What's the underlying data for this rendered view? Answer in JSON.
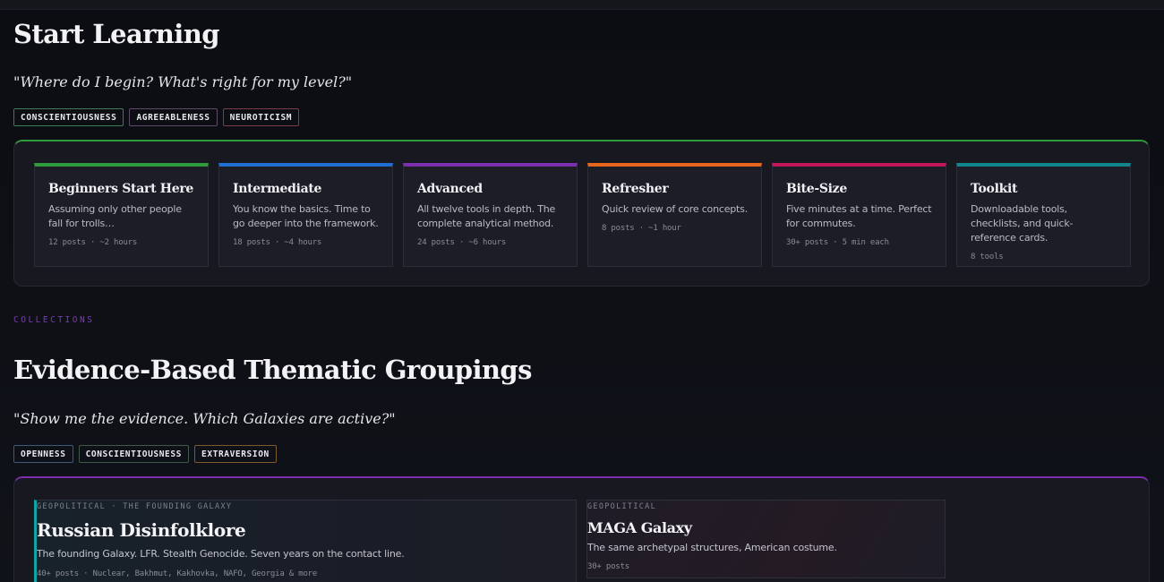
{
  "start": {
    "title": "Start Learning",
    "quote": "\"Where do I begin? What's right for my level?\"",
    "tags": [
      {
        "label": "CONSCIENTIOUSNESS",
        "color": "#3f7d57"
      },
      {
        "label": "AGREEABLENESS",
        "color": "#5c4a66"
      },
      {
        "label": "NEUROTICISM",
        "color": "#7a3d46"
      }
    ],
    "accent": "#2f9a3c",
    "cards": [
      {
        "title": "Beginners Start Here",
        "desc": "Assuming only other people fall for trolls…",
        "meta": "12 posts · ~2 hours",
        "color": "#2f9a3c"
      },
      {
        "title": "Intermediate",
        "desc": "You know the basics. Time to go deeper into the framework.",
        "meta": "18 posts · ~4 hours",
        "color": "#1f6fd0"
      },
      {
        "title": "Advanced",
        "desc": "All twelve tools in depth. The complete analytical method.",
        "meta": "24 posts · ~6 hours",
        "color": "#7b2fb0"
      },
      {
        "title": "Refresher",
        "desc": "Quick review of core concepts.",
        "meta": "8 posts · ~1 hour",
        "color": "#e8651c"
      },
      {
        "title": "Bite-Size",
        "desc": "Five minutes at a time. Perfect for commutes.",
        "meta": "30+ posts · 5 min each",
        "color": "#c2185b"
      },
      {
        "title": "Toolkit",
        "desc": "Downloadable tools, checklists, and quick-reference cards.",
        "meta": "8 tools",
        "color": "#10868c"
      }
    ]
  },
  "collections": {
    "eyebrow": "COLLECTIONS",
    "title": "Evidence-Based Thematic Groupings",
    "quote": "\"Show me the evidence. Which Galaxies are active?\"",
    "tags": [
      {
        "label": "OPENNESS",
        "color": "#3d5a78"
      },
      {
        "label": "CONSCIENTIOUSNESS",
        "color": "#3f5a4a"
      },
      {
        "label": "EXTRAVERSION",
        "color": "#7a5a2e"
      }
    ],
    "accent": "#7b2fb0",
    "galaxies": [
      {
        "kicker": "GEOPOLITICAL · THE FOUNDING GALAXY",
        "title": "Russian Disinfolklore",
        "desc": "The founding Galaxy. LFR. Stealth Genocide. Seven years on the contact line.",
        "meta": "40+ posts · Nuclear, Bakhmut, Kakhovka, NAFO, Georgia & more",
        "color": "#10a3a8"
      },
      {
        "kicker": "GEOPOLITICAL",
        "title": "MAGA Galaxy",
        "desc": "The same archetypal structures, American costume.",
        "meta": "30+ posts"
      }
    ]
  }
}
